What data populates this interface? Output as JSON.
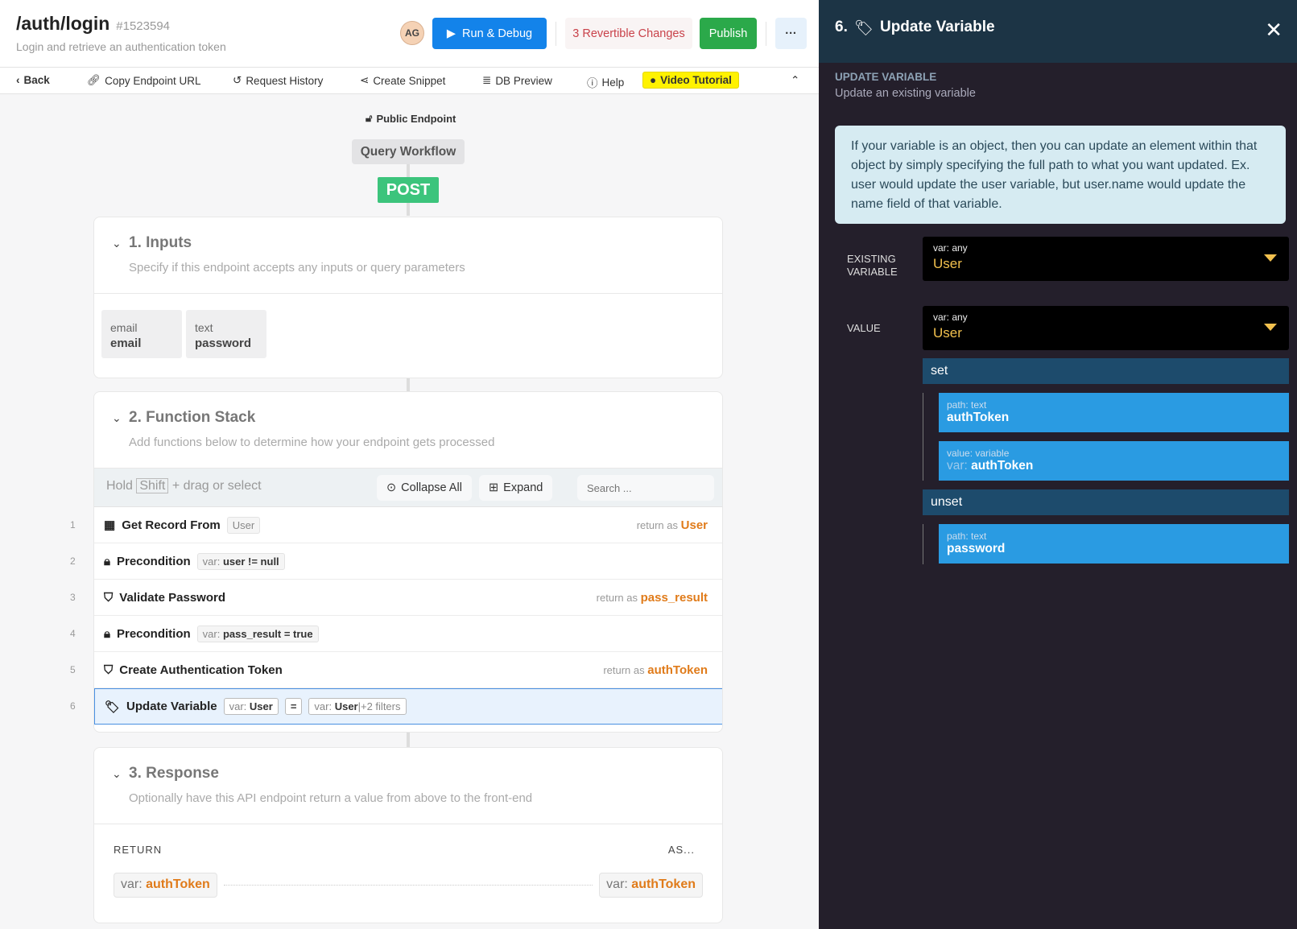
{
  "header": {
    "title": "/auth/login",
    "id": "#1523594",
    "subtitle": "Login and retrieve an authentication token",
    "avatar": "AG",
    "run_label": "Run & Debug",
    "revertible_label": "3 Revertible Changes",
    "publish_label": "Publish",
    "more_label": "···"
  },
  "toolbar": {
    "back": "Back",
    "copy_url": "Copy Endpoint URL",
    "history": "Request History",
    "snippet": "Create Snippet",
    "db_preview": "DB Preview",
    "help": "Help",
    "video": "Video Tutorial"
  },
  "workflow": {
    "public_endpoint": "Public Endpoint",
    "query_workflow": "Query Workflow",
    "method": "POST"
  },
  "inputs": {
    "title": "1. Inputs",
    "desc": "Specify if this endpoint accepts any inputs or query parameters",
    "items": [
      {
        "type": "email",
        "name": "email"
      },
      {
        "type": "text",
        "name": "password"
      }
    ]
  },
  "stack": {
    "title": "2. Function Stack",
    "desc": "Add functions below to determine how your endpoint gets processed",
    "hold": "Hold",
    "shift": "Shift",
    "drag": "+ drag or select",
    "collapse": "Collapse All",
    "expand": "Expand",
    "search_placeholder": "Search ...",
    "rows": [
      {
        "n": "1",
        "name": "Get Record From",
        "tag": "User",
        "ret_label": "return as",
        "ret": "User"
      },
      {
        "n": "2",
        "name": "Precondition",
        "tag_pre": "var:",
        "tag": "user != null"
      },
      {
        "n": "3",
        "name": "Validate Password",
        "ret_label": "return as",
        "ret": "pass_result"
      },
      {
        "n": "4",
        "name": "Precondition",
        "tag_pre": "var:",
        "tag": "pass_result = true"
      },
      {
        "n": "5",
        "name": "Create Authentication Token",
        "ret_label": "return as",
        "ret": "authToken"
      },
      {
        "n": "6",
        "name": "Update Variable",
        "tag_pre": "var:",
        "tag": "User",
        "eq": "=",
        "tag2_pre": "var:",
        "tag2": "User",
        "tag2_suffix": "|+2 filters"
      }
    ]
  },
  "response": {
    "title": "3. Response",
    "desc": "Optionally have this API endpoint return a value from above to the front-end",
    "return_label": "RETURN",
    "as_label": "AS...",
    "var_prefix": "var:",
    "return_value": "authToken",
    "as_value": "authToken"
  },
  "panel": {
    "title": "6.",
    "title_name": "Update Variable",
    "section": "UPDATE VARIABLE",
    "section_desc": "Update an existing variable",
    "info": "If your variable is an object, then you can update an element within that object by simply specifying the full path to what you want updated. Ex. user would update the user variable, but user.name would update the name field of that variable.",
    "existing_label_1": "EXISTING",
    "existing_label_2": "VARIABLE",
    "existing_type": "var: any",
    "existing_value": "User",
    "value_label": "VALUE",
    "value_type": "var: any",
    "value_value": "User",
    "set_label": "set",
    "set_items": [
      {
        "sub": "path: text",
        "val": "authToken"
      },
      {
        "sub": "value: variable",
        "pre": "var:",
        "val": "authToken"
      }
    ],
    "unset_label": "unset",
    "unset_items": [
      {
        "sub": "path: text",
        "val": "password"
      }
    ]
  }
}
